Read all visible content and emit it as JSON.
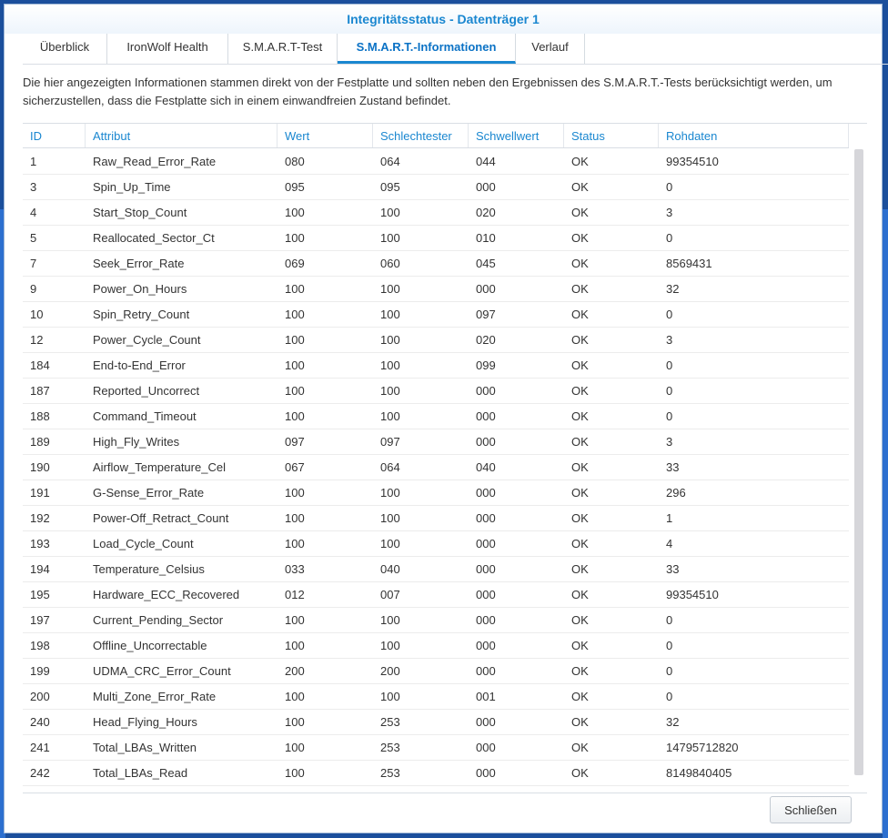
{
  "window": {
    "title": "Integritätsstatus - Datenträger 1"
  },
  "tabs": [
    {
      "label": "Überblick",
      "active": false
    },
    {
      "label": "IronWolf Health",
      "active": false
    },
    {
      "label": "S.M.A.R.T-Test",
      "active": false
    },
    {
      "label": "S.M.A.R.T.-Informationen",
      "active": true
    },
    {
      "label": "Verlauf",
      "active": false
    }
  ],
  "description": "Die hier angezeigten Informationen stammen direkt von der Festplatte und sollten neben den Ergebnissen des S.M.A.R.T.-Tests berücksichtigt werden, um sicherzustellen, dass die Festplatte sich in einem einwandfreien Zustand befindet.",
  "table": {
    "columns": [
      "ID",
      "Attribut",
      "Wert",
      "Schlechtester",
      "Schwellwert",
      "Status",
      "Rohdaten"
    ],
    "rows": [
      [
        "1",
        "Raw_Read_Error_Rate",
        "080",
        "064",
        "044",
        "OK",
        "99354510"
      ],
      [
        "3",
        "Spin_Up_Time",
        "095",
        "095",
        "000",
        "OK",
        "0"
      ],
      [
        "4",
        "Start_Stop_Count",
        "100",
        "100",
        "020",
        "OK",
        "3"
      ],
      [
        "5",
        "Reallocated_Sector_Ct",
        "100",
        "100",
        "010",
        "OK",
        "0"
      ],
      [
        "7",
        "Seek_Error_Rate",
        "069",
        "060",
        "045",
        "OK",
        "8569431"
      ],
      [
        "9",
        "Power_On_Hours",
        "100",
        "100",
        "000",
        "OK",
        "32"
      ],
      [
        "10",
        "Spin_Retry_Count",
        "100",
        "100",
        "097",
        "OK",
        "0"
      ],
      [
        "12",
        "Power_Cycle_Count",
        "100",
        "100",
        "020",
        "OK",
        "3"
      ],
      [
        "184",
        "End-to-End_Error",
        "100",
        "100",
        "099",
        "OK",
        "0"
      ],
      [
        "187",
        "Reported_Uncorrect",
        "100",
        "100",
        "000",
        "OK",
        "0"
      ],
      [
        "188",
        "Command_Timeout",
        "100",
        "100",
        "000",
        "OK",
        "0"
      ],
      [
        "189",
        "High_Fly_Writes",
        "097",
        "097",
        "000",
        "OK",
        "3"
      ],
      [
        "190",
        "Airflow_Temperature_Cel",
        "067",
        "064",
        "040",
        "OK",
        "33"
      ],
      [
        "191",
        "G-Sense_Error_Rate",
        "100",
        "100",
        "000",
        "OK",
        "296"
      ],
      [
        "192",
        "Power-Off_Retract_Count",
        "100",
        "100",
        "000",
        "OK",
        "1"
      ],
      [
        "193",
        "Load_Cycle_Count",
        "100",
        "100",
        "000",
        "OK",
        "4"
      ],
      [
        "194",
        "Temperature_Celsius",
        "033",
        "040",
        "000",
        "OK",
        "33"
      ],
      [
        "195",
        "Hardware_ECC_Recovered",
        "012",
        "007",
        "000",
        "OK",
        "99354510"
      ],
      [
        "197",
        "Current_Pending_Sector",
        "100",
        "100",
        "000",
        "OK",
        "0"
      ],
      [
        "198",
        "Offline_Uncorrectable",
        "100",
        "100",
        "000",
        "OK",
        "0"
      ],
      [
        "199",
        "UDMA_CRC_Error_Count",
        "200",
        "200",
        "000",
        "OK",
        "0"
      ],
      [
        "200",
        "Multi_Zone_Error_Rate",
        "100",
        "100",
        "001",
        "OK",
        "0"
      ],
      [
        "240",
        "Head_Flying_Hours",
        "100",
        "253",
        "000",
        "OK",
        "32"
      ],
      [
        "241",
        "Total_LBAs_Written",
        "100",
        "253",
        "000",
        "OK",
        "14795712820"
      ],
      [
        "242",
        "Total_LBAs_Read",
        "100",
        "253",
        "000",
        "OK",
        "8149840405"
      ]
    ]
  },
  "footer": {
    "close_label": "Schließen"
  }
}
